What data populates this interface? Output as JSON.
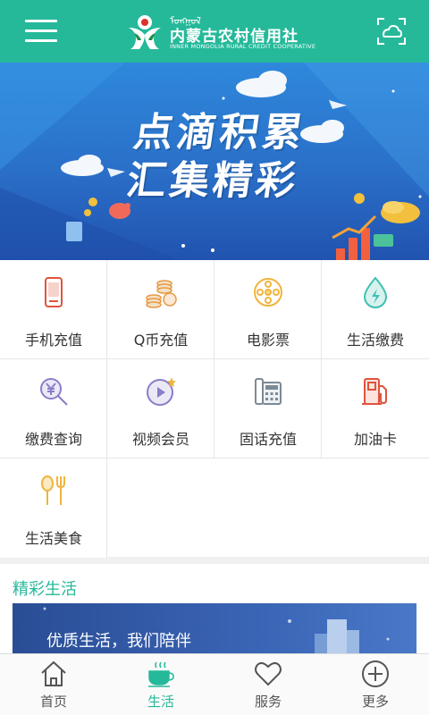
{
  "header": {
    "logo_mongolian": "ᠮᠣᠩᠭᠣᠯ",
    "logo_cn": "内蒙古农村信用社",
    "logo_en": "INNER MONGOLIA RURAL CREDIT COOPERATIVE",
    "accent": "#25b99a"
  },
  "banner": {
    "line1": "点滴积累",
    "line2": "汇集精彩"
  },
  "services": [
    {
      "label": "手机充值",
      "icon": "phone-icon"
    },
    {
      "label": "Q币充值",
      "icon": "coins-icon"
    },
    {
      "label": "电影票",
      "icon": "film-reel-icon"
    },
    {
      "label": "生活缴费",
      "icon": "water-drop-bolt-icon"
    },
    {
      "label": "缴费查询",
      "icon": "yuan-search-icon"
    },
    {
      "label": "视频会员",
      "icon": "video-play-icon"
    },
    {
      "label": "固话充值",
      "icon": "landline-phone-icon"
    },
    {
      "label": "加油卡",
      "icon": "fuel-pump-icon"
    },
    {
      "label": "生活美食",
      "icon": "fork-spoon-icon"
    }
  ],
  "section": {
    "title": "精彩生活",
    "promo_text": "优质生活，我们陪伴"
  },
  "tabs": [
    {
      "label": "首页",
      "icon": "home-icon",
      "active": false
    },
    {
      "label": "生活",
      "icon": "coffee-cup-icon",
      "active": true
    },
    {
      "label": "服务",
      "icon": "heart-icon",
      "active": false
    },
    {
      "label": "更多",
      "icon": "plus-circle-icon",
      "active": false
    }
  ]
}
